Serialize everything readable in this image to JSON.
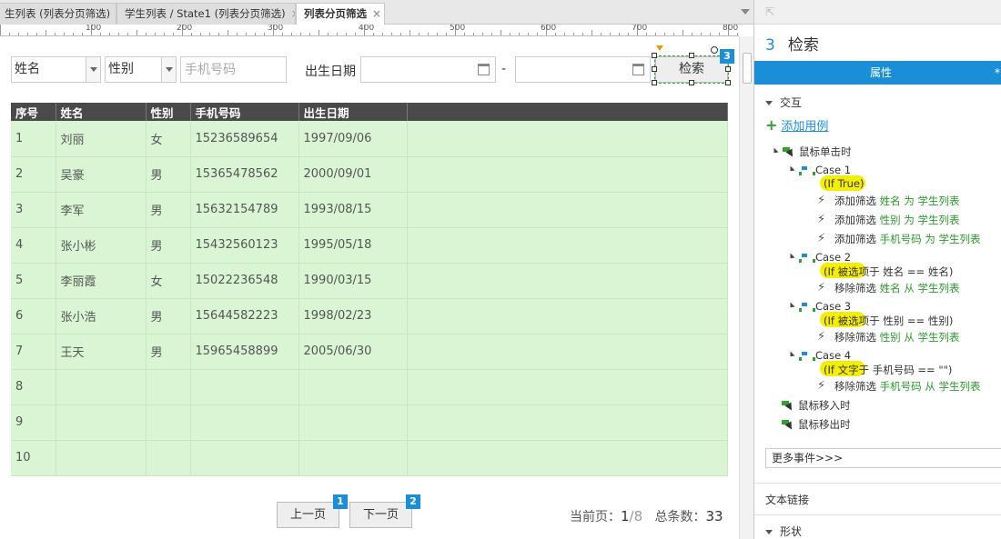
{
  "tabs": [
    {
      "label": "生列表 (列表分页筛选)",
      "close": "×"
    },
    {
      "label": "学生列表 / State1 (列表分页筛选)",
      "close": "×"
    },
    {
      "label": "列表分页筛选",
      "close": "×"
    }
  ],
  "ruler": {
    "labels": [
      "100",
      "200",
      "300",
      "400",
      "500",
      "600",
      "700",
      "800"
    ]
  },
  "filters": {
    "name_select": "姓名",
    "gender_select": "性别",
    "phone_placeholder": "手机号码",
    "birth_label": "出生日期",
    "range_sep": "-",
    "search_button": "检索",
    "search_badge": "3"
  },
  "table": {
    "headers": [
      "序号",
      "姓名",
      "性别",
      "手机号码",
      "出生日期",
      ""
    ],
    "rows": [
      [
        "1",
        "刘丽",
        "女",
        "15236589654",
        "1997/09/06"
      ],
      [
        "2",
        "吴豪",
        "男",
        "15365478562",
        "2000/09/01"
      ],
      [
        "3",
        "李军",
        "男",
        "15632154789",
        "1993/08/15"
      ],
      [
        "4",
        "张小彬",
        "男",
        "15432560123",
        "1995/05/18"
      ],
      [
        "5",
        "李丽霞",
        "女",
        "15022236548",
        "1990/03/15"
      ],
      [
        "6",
        "张小浩",
        "男",
        "15644582223",
        "1998/02/23"
      ],
      [
        "7",
        "王天",
        "男",
        "15965458899",
        "2005/06/30"
      ],
      [
        "8",
        "",
        "",
        "",
        ""
      ],
      [
        "9",
        "",
        "",
        "",
        ""
      ],
      [
        "10",
        "",
        "",
        "",
        ""
      ]
    ]
  },
  "pager": {
    "prev": "上一页",
    "prev_badge": "1",
    "next": "下一页",
    "next_badge": "2",
    "current_label": "当前页：",
    "current": "1",
    "total_pages": "/8",
    "count_label": "总条数：",
    "count": "33"
  },
  "panel": {
    "widget_num": "3",
    "widget_name": "检索",
    "tab_label": "属性",
    "tab_extra": "*",
    "interaction": "交互",
    "add_case": "添加用例",
    "on_click": "鼠标单击时",
    "cases": [
      {
        "name": "Case 1",
        "cond": "(If True)",
        "actions": [
          {
            "verb": "添加筛选",
            "a": "姓名",
            "mid": "为",
            "b": "学生列表"
          },
          {
            "verb": "添加筛选",
            "a": "性别",
            "mid": "为",
            "b": "学生列表"
          },
          {
            "verb": "添加筛选",
            "a": "手机号码",
            "mid": "为",
            "b": "学生列表"
          }
        ]
      },
      {
        "name": "Case 2",
        "cond": "(If 被选项于 姓名 == 姓名)",
        "actions": [
          {
            "verb": "移除筛选",
            "a": "姓名",
            "mid": "从",
            "b": "学生列表"
          }
        ]
      },
      {
        "name": "Case 3",
        "cond": "(If 被选项于 性别 == 性别)",
        "actions": [
          {
            "verb": "移除筛选",
            "a": "性别",
            "mid": "从",
            "b": "学生列表"
          }
        ]
      },
      {
        "name": "Case 4",
        "cond": "(If 文字于 手机号码 == \"\")",
        "actions": [
          {
            "verb": "移除筛选",
            "a": "手机号码",
            "mid": "从",
            "b": "学生列表"
          }
        ]
      }
    ],
    "on_enter": "鼠标移入时",
    "on_leave": "鼠标移出时",
    "more_events": "更多事件>>>",
    "text_link": "文本链接",
    "shape": "形状"
  }
}
